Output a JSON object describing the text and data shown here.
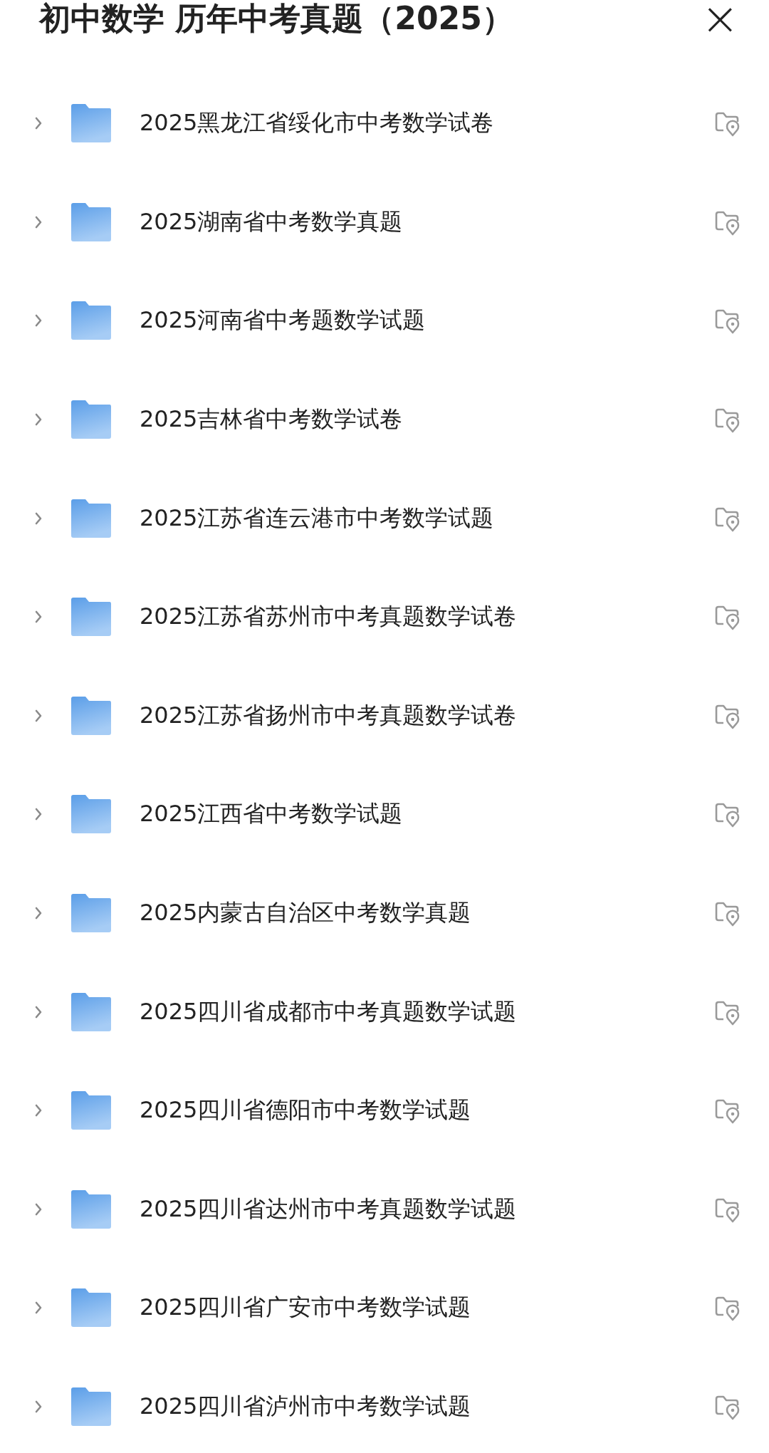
{
  "header": {
    "title": "初中数学 历年中考真题（2025）",
    "close": "×"
  },
  "folders": [
    {
      "name": "2025黑龙江省绥化市中考数学试卷",
      "expanded": false
    },
    {
      "name": "2025湖南省中考数学真题",
      "expanded": false
    },
    {
      "name": "2025河南省中考题数学试题",
      "expanded": false
    },
    {
      "name": "2025吉林省中考数学试卷",
      "expanded": false
    },
    {
      "name": "2025江苏省连云港市中考数学试题",
      "expanded": false
    },
    {
      "name": "2025江苏省苏州市中考真题数学试卷",
      "expanded": false
    },
    {
      "name": "2025江苏省扬州市中考真题数学试卷",
      "expanded": false
    },
    {
      "name": "2025江西省中考数学试题",
      "expanded": false
    },
    {
      "name": "2025内蒙古自治区中考数学真题",
      "expanded": false
    },
    {
      "name": "2025四川省成都市中考真题数学试题",
      "expanded": false
    },
    {
      "name": "2025四川省德阳市中考数学试题",
      "expanded": false
    },
    {
      "name": "2025四川省达州市中考真题数学试题",
      "expanded": false
    },
    {
      "name": "2025四川省广安市中考数学试题",
      "expanded": false
    },
    {
      "name": "2025四川省泸州市中考数学试题",
      "expanded": false
    }
  ]
}
